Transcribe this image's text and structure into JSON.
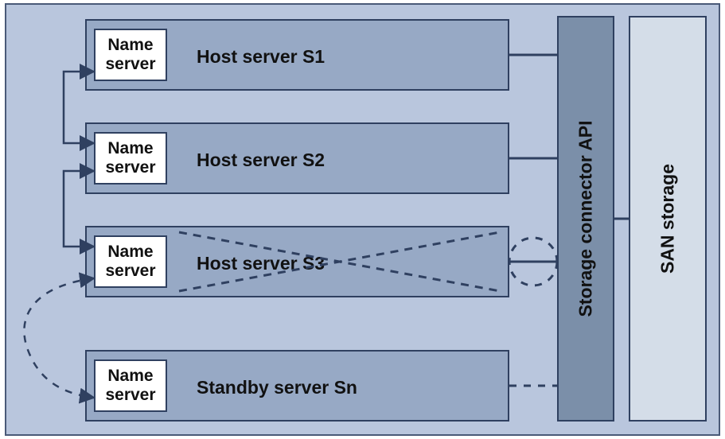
{
  "diagram": {
    "outer_box": true,
    "name_server_label": "Name\nserver",
    "servers": [
      {
        "title": "Host server S1",
        "kind": "host",
        "failed": false,
        "connected": true,
        "conn_style": "solid"
      },
      {
        "title": "Host server S2",
        "kind": "host",
        "failed": false,
        "connected": true,
        "conn_style": "solid"
      },
      {
        "title": "Host server S3",
        "kind": "host",
        "failed": true,
        "connected": true,
        "conn_style": "solid"
      },
      {
        "title": "Standby server Sn",
        "kind": "standby",
        "failed": false,
        "connected": true,
        "conn_style": "dashed"
      }
    ],
    "api_label": "Storage connector  API",
    "san_label": "SAN storage",
    "name_server_links": {
      "description": "left-side arrows connecting name-server boxes",
      "solid_links": [
        [
          0,
          1
        ],
        [
          1,
          2
        ]
      ],
      "dashed_failover": {
        "from": 2,
        "to": 3,
        "desc": "failover from S3 to standby Sn"
      }
    }
  }
}
